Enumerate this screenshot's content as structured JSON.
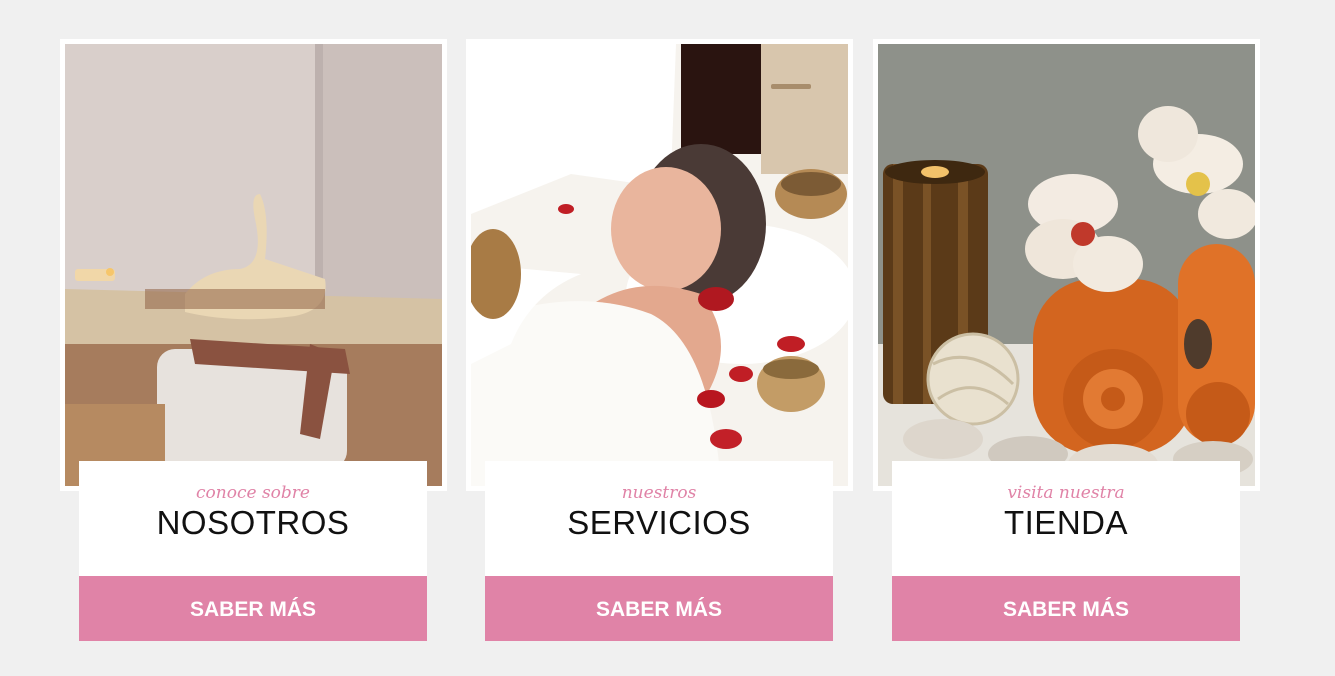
{
  "colors": {
    "accent": "#e083a7",
    "background": "#f0f0f0",
    "card": "#ffffff",
    "title_text": "#111111"
  },
  "cards": [
    {
      "subtitle": "conoce sobre",
      "title": "NOSOTROS",
      "button_label": "SABER MÁS",
      "image_icon": "spa-room-towel-swan-image"
    },
    {
      "subtitle": "nuestros",
      "title": "SERVICIOS",
      "button_label": "SABER MÁS",
      "image_icon": "facial-treatment-singing-bowls-image"
    },
    {
      "subtitle": "visita nuestra",
      "title": "TIENDA",
      "button_label": "SABER MÁS",
      "image_icon": "candle-orchid-towels-image"
    }
  ]
}
